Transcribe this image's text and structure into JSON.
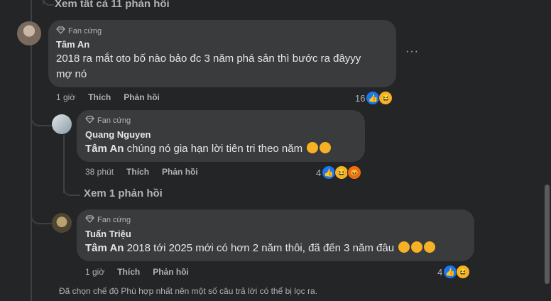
{
  "top_link": "Xem tất cả 11 phản hồi",
  "comments": [
    {
      "badge": "Fan cứng",
      "author": "Tâm An",
      "text_line1": "2018 ra mắt oto bố nào bảo đc 3 năm phá sản thì bước ra đâyyy",
      "text_line2": "mợ nó",
      "time": "1 giờ",
      "like": "Thích",
      "reply": "Phản hồi",
      "reaction_count": "16",
      "more": "···"
    },
    {
      "badge": "Fan cứng",
      "author": "Quang Nguyen",
      "mention": "Tâm An",
      "text": " chúng nó gia hạn lời tiên tri theo năm",
      "time": "38 phút",
      "like": "Thích",
      "reply": "Phản hồi",
      "reaction_count": "4",
      "view_replies": "Xem 1 phản hồi"
    },
    {
      "badge": "Fan cứng",
      "author": "Tuấn Triệu",
      "mention": "Tâm An",
      "text": " 2018 tới 2025 mới có hơn 2 năm thôi, đã đến 3 năm đâu",
      "time": "1 giờ",
      "like": "Thích",
      "reply": "Phản hồi",
      "reaction_count": "4"
    }
  ],
  "footer": "Đã chọn chế độ Phù hợp nhất nên một số câu trả lời có thể bị lọc ra.",
  "icons": {
    "badge": "diamond-icon",
    "like": "like-icon",
    "haha": "haha-icon",
    "angry": "angry-icon"
  }
}
